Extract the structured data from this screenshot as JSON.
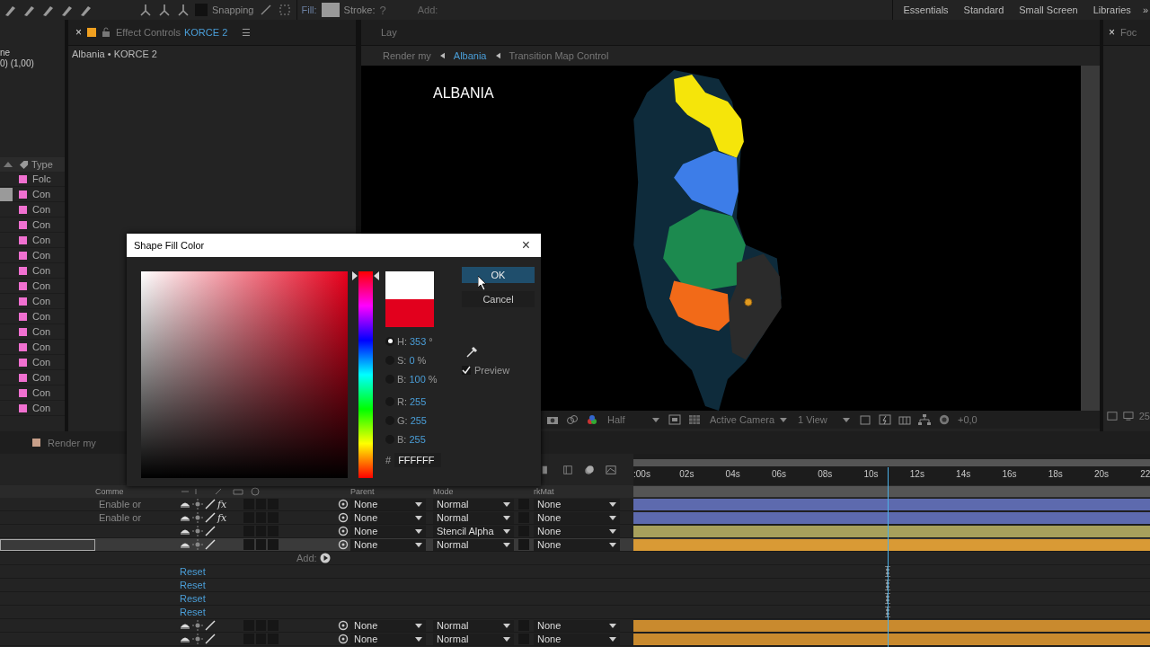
{
  "toolbar": {
    "snapping": {
      "label": "Snapping",
      "checked": false
    },
    "fill_label": "Fill:",
    "stroke_label": "Stroke:",
    "stroke_value": "?",
    "add_label": "Add:"
  },
  "workspaces": [
    {
      "label": "Essentials"
    },
    {
      "label": "Standard"
    },
    {
      "label": "Small Screen"
    },
    {
      "label": "Libraries"
    }
  ],
  "workspace_more": "»",
  "project_panel": {
    "info_lines": [
      "ne",
      "0) (1,00)"
    ],
    "type_header": "Type",
    "items": [
      {
        "label": "Folc",
        "selected": false
      },
      {
        "label": "Con",
        "selected": true
      },
      {
        "label": "Con",
        "selected": false
      },
      {
        "label": "Con",
        "selected": false
      },
      {
        "label": "Con",
        "selected": false
      },
      {
        "label": "Con",
        "selected": false
      },
      {
        "label": "Con",
        "selected": false
      },
      {
        "label": "Con",
        "selected": false
      },
      {
        "label": "Con",
        "selected": false
      },
      {
        "label": "Con",
        "selected": false
      },
      {
        "label": "Con",
        "selected": false
      },
      {
        "label": "Con",
        "selected": false
      },
      {
        "label": "Con",
        "selected": false
      },
      {
        "label": "Con",
        "selected": false
      },
      {
        "label": "Con",
        "selected": false
      },
      {
        "label": "Con",
        "selected": false
      }
    ]
  },
  "effect_controls": {
    "close": "×",
    "tab_title": "Effect Controls",
    "tab_layer": "KORCE 2",
    "menu": "☰",
    "subtitle": "Albania • KORCE 2"
  },
  "viewer": {
    "tab": "Lay",
    "breadcrumbs": [
      {
        "label": "Render my",
        "selected": false
      },
      {
        "label": "Albania",
        "selected": true
      },
      {
        "label": "Transition Map Control",
        "selected": false
      }
    ],
    "composition_title": "ALBANIA",
    "resolution": "Half",
    "camera": "Active Camera",
    "views": "1 View",
    "exposure": "+0,0"
  },
  "right_panel": {
    "close": "×",
    "tab": "Foc",
    "frame_label": "25"
  },
  "timeline": {
    "tab": "Render my",
    "ticks": [
      ":00s",
      "02s",
      "04s",
      "06s",
      "08s",
      "10s",
      "12s",
      "14s",
      "16s",
      "18s",
      "20s",
      "22"
    ],
    "columns": {
      "comment": "Comme",
      "parent": "Parent",
      "mode": "Mode",
      "track_matte": "rkMat"
    },
    "rows": [
      {
        "kind": "layer",
        "comment": "Enable or",
        "effects": "fx",
        "parent": "None",
        "mode": "Normal",
        "track_matte": "None",
        "color": "#5d6aae",
        "selected": false
      },
      {
        "kind": "layer",
        "comment": "Enable or",
        "effects": "fx",
        "parent": "None",
        "mode": "Normal",
        "track_matte": "None",
        "color": "#5d6aae",
        "selected": false
      },
      {
        "kind": "layer",
        "parent": "None",
        "mode": "Stencil Alpha",
        "track_matte": "None",
        "color": "#a7a05c",
        "selected": false
      },
      {
        "kind": "layer",
        "parent": "None",
        "mode": "Normal",
        "track_matte": "None",
        "color": "#d99a35",
        "selected": true
      },
      {
        "kind": "add",
        "label": "Add:"
      },
      {
        "kind": "reset",
        "label": "Reset"
      },
      {
        "kind": "reset",
        "label": "Reset"
      },
      {
        "kind": "reset",
        "label": "Reset"
      },
      {
        "kind": "reset",
        "label": "Reset"
      },
      {
        "kind": "layer",
        "parent": "None",
        "mode": "Normal",
        "track_matte": "None",
        "color": "#c98a2e",
        "selected": false
      },
      {
        "kind": "layer",
        "parent": "None",
        "mode": "Normal",
        "track_matte": "None",
        "color": "#c98a2e",
        "selected": false
      }
    ]
  },
  "dialog": {
    "title": "Shape Fill Color",
    "close": "×",
    "fields": [
      {
        "label": "H:",
        "value": "353",
        "unit": "°",
        "selected": true
      },
      {
        "label": "S:",
        "value": "0",
        "unit": "%",
        "selected": false
      },
      {
        "label": "B:",
        "value": "100",
        "unit": "%",
        "selected": false
      },
      {
        "label": "R:",
        "value": "255",
        "selected": false
      },
      {
        "label": "G:",
        "value": "255",
        "selected": false
      },
      {
        "label": "B:",
        "value": "255",
        "selected": false
      }
    ],
    "hue": {
      "level": 0.02
    },
    "hex_label": "#",
    "hex": "FFFFFF",
    "ok": "OK",
    "cancel": "Cancel",
    "preview": {
      "label": "Preview",
      "checked": true
    }
  }
}
